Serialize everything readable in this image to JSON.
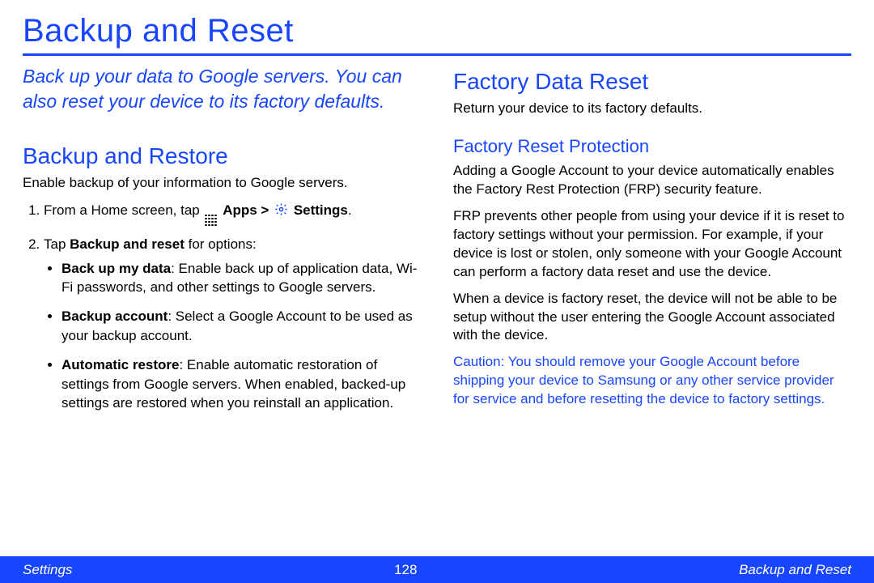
{
  "title": "Backup and Reset",
  "intro": "Back up your data to Google servers. You can also reset your device to its factory defaults.",
  "left": {
    "h2": "Backup and Restore",
    "lead": "Enable backup of your information to Google servers.",
    "step1_pre": "From a Home screen, tap ",
    "apps_label": "Apps",
    "gt": " > ",
    "settings_label": "Settings",
    "step1_post": ".",
    "step2_pre": "Tap ",
    "step2_bold": "Backup and reset",
    "step2_post": " for options:",
    "bullets": {
      "b1_bold": "Back up my data",
      "b1_rest": ": Enable back up of application data, Wi-Fi passwords, and other settings to Google servers.",
      "b2_bold": "Backup account",
      "b2_rest": ": Select a Google Account to be used as your backup account.",
      "b3_bold": "Automatic restore",
      "b3_rest": ": Enable automatic restoration of settings from Google servers. When enabled, backed-up settings are restored when you reinstall an application."
    }
  },
  "right": {
    "h2": "Factory Data Reset",
    "lead": "Return your device to its factory defaults.",
    "h3": "Factory Reset Protection",
    "p1": "Adding a Google Account to your device automatically enables the Factory Rest Protection (FRP) security feature.",
    "p2": "FRP prevents other people from using your device if it is reset to factory settings without your permission. For example, if your device is lost or stolen, only someone with your Google Account can perform a factory data reset and use the device.",
    "p3": "When a device is factory reset, the device will not be able to be setup without the user entering the Google Account associated with the device.",
    "caution_label": "Caution",
    "caution_body": ": You should remove your Google Account before shipping your device to Samsung or any other service provider for service and before resetting the device to factory settings."
  },
  "footer": {
    "left": "Settings",
    "center": "128",
    "right": "Backup and Reset"
  }
}
